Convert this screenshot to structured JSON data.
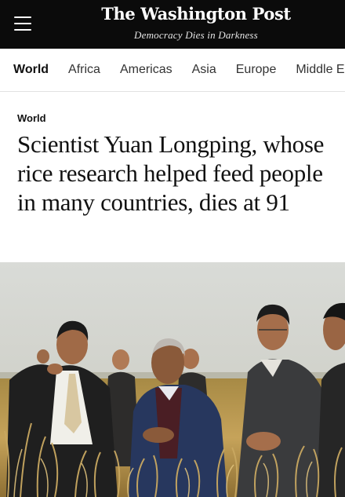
{
  "header": {
    "masthead": "The Washington Post",
    "tagline": "Democracy Dies in Darkness"
  },
  "nav": {
    "items": [
      "World",
      "Africa",
      "Americas",
      "Asia",
      "Europe",
      "Middle East"
    ]
  },
  "article": {
    "kicker": "World",
    "headline": "Scientist Yuan Longping, whose rice research helped feed people in many countries, dies at 91"
  },
  "colors": {
    "header_bg": "#0b0b0b",
    "text": "#111111"
  }
}
